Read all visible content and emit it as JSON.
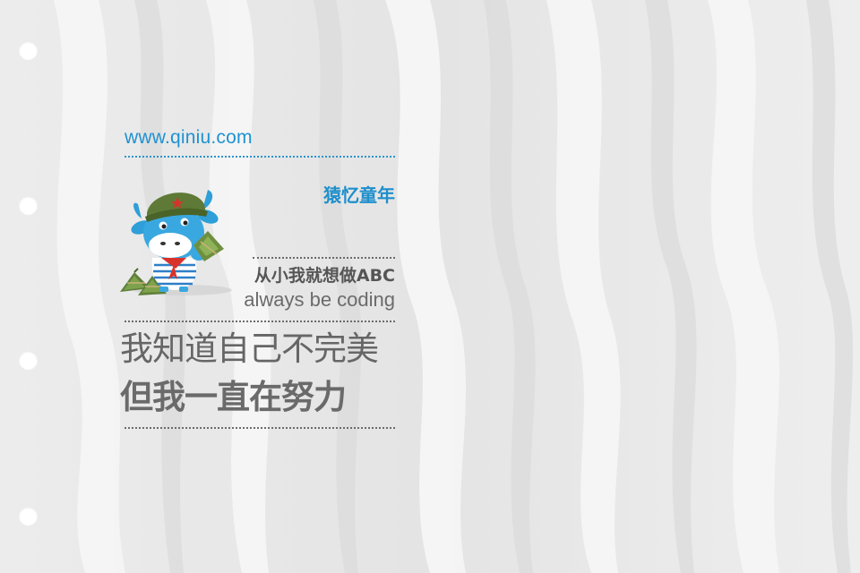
{
  "site": {
    "url": "www.qiniu.com"
  },
  "campaign": {
    "title": "猿忆童年"
  },
  "tagline": {
    "dream": "从小我就想做ABC",
    "motto": "always be coding"
  },
  "headline": {
    "line1": "我知道自己不完美",
    "line2": "但我一直在努力"
  },
  "icons": {
    "mascot": "qiniu-bull-mascot-illustration",
    "binder_holes": "binder-hole-icon"
  },
  "colors": {
    "background": "#e8e8e8",
    "brand_blue": "#1f92d1",
    "text_grey": "#666666"
  }
}
